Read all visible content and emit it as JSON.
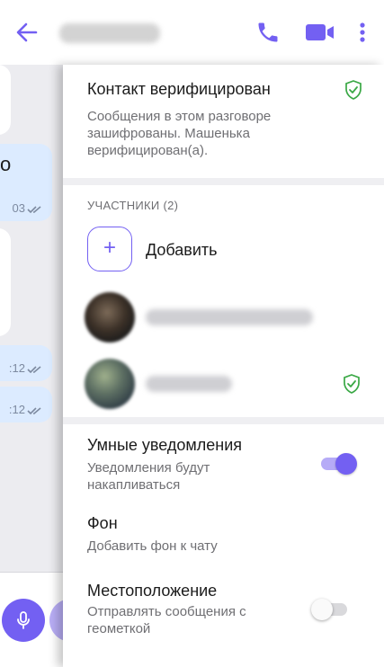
{
  "header": {
    "back_icon": "arrow-left-icon",
    "contact_name": "Машенька",
    "call_icon": "phone-icon",
    "video_icon": "video-camera-icon",
    "more_icon": "more-vertical-icon",
    "accent_color": "#7360f2"
  },
  "chat": {
    "messages": [
      {
        "direction": "in"
      },
      {
        "direction": "out",
        "text": "о",
        "time": "03",
        "status_icon": "double-check-icon"
      },
      {
        "direction": "in"
      },
      {
        "direction": "out",
        "time": ":12",
        "status_icon": "double-check-icon"
      },
      {
        "direction": "out",
        "time": ":12",
        "status_icon": "double-check-icon"
      }
    ],
    "mic_icon": "microphone-icon"
  },
  "panel": {
    "verification": {
      "title": "Контакт верифицирован",
      "description": "Сообщения в этом разговоре зашифрованы. Машенька верифицирован(а).",
      "shield_icon": "shield-check-icon",
      "shield_color": "#3aa845"
    },
    "members": {
      "label": "УЧАСТНИКИ (2)",
      "add_label": "Добавить",
      "add_icon": "plus-icon",
      "items": [
        {
          "name": "Вы (Пользователь)",
          "verified": false
        },
        {
          "name": "Машенька",
          "verified": true
        }
      ]
    },
    "settings": [
      {
        "title": "Умные уведомления",
        "description": "Уведомления будут накапливаться",
        "toggle": true
      },
      {
        "title": "Фон",
        "description": "Добавить фон к чату"
      },
      {
        "title": "Местоположение",
        "description": "Отправлять сообщения с геометкой",
        "toggle": false
      }
    ]
  }
}
